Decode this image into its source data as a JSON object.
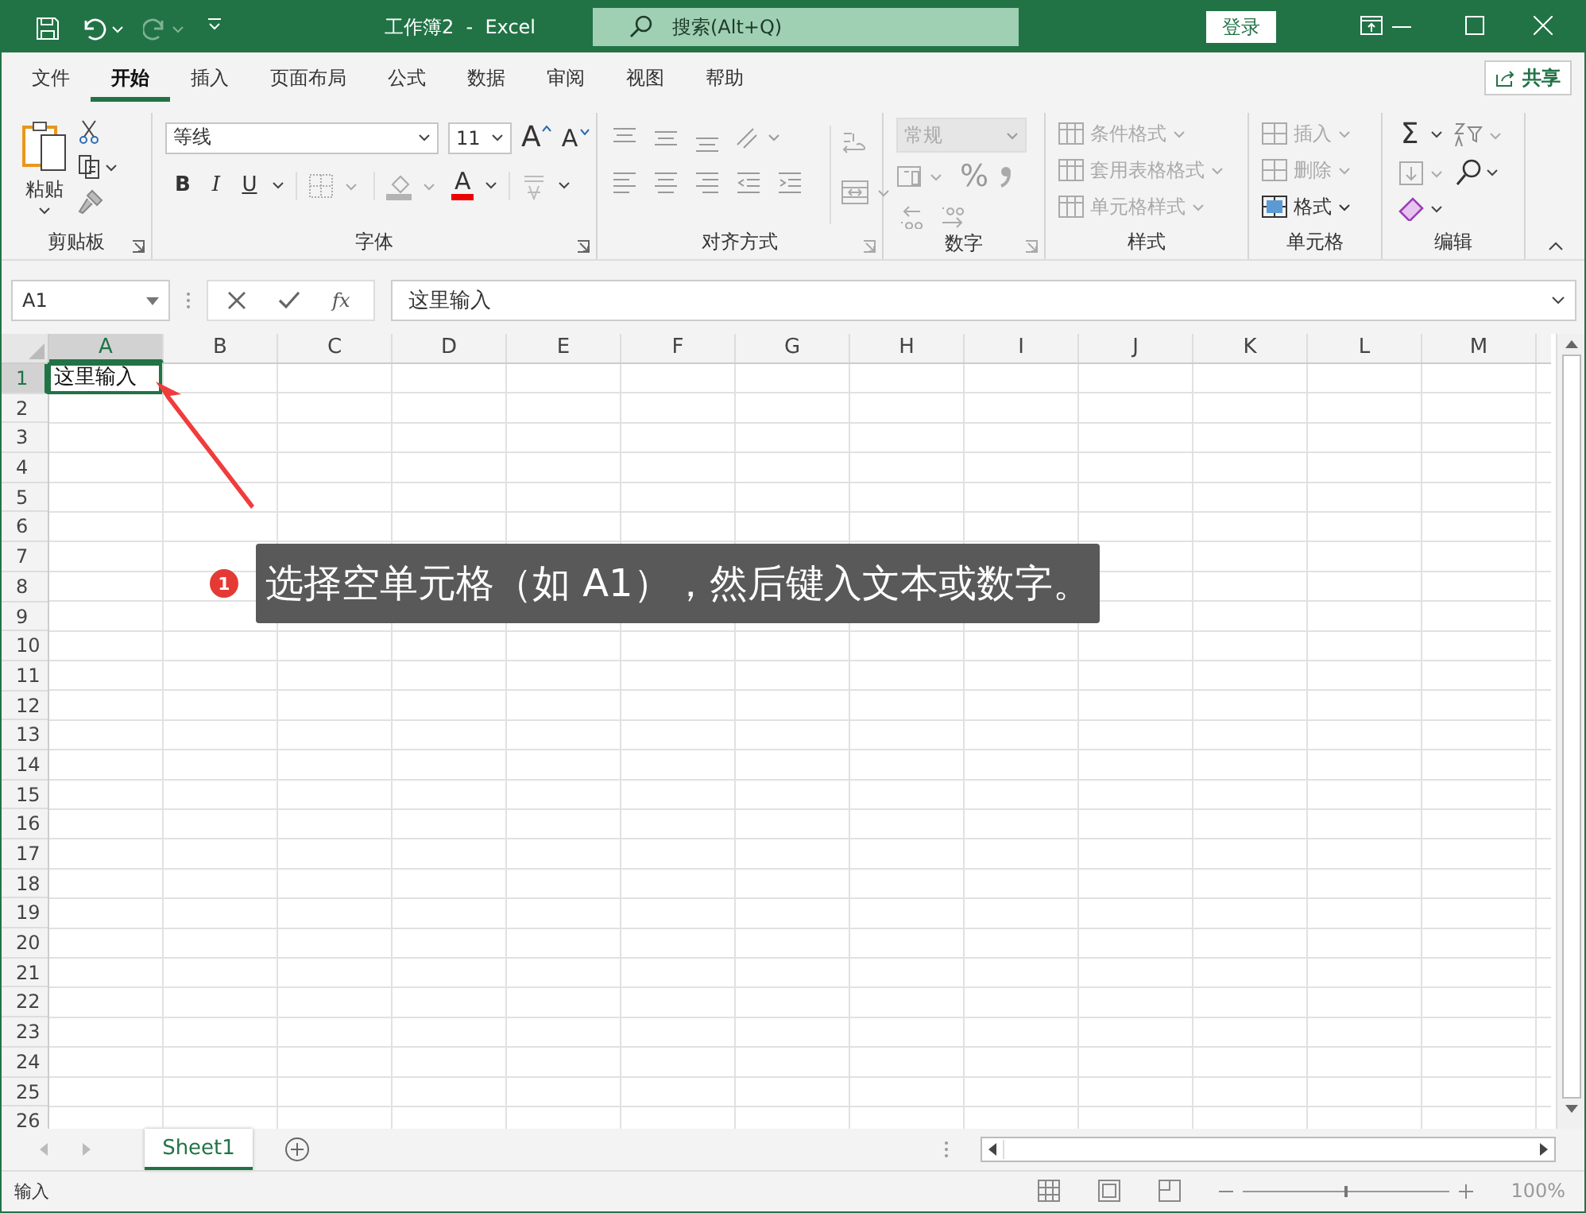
{
  "title_bar": {
    "title": "工作簿2  -  Excel",
    "search_placeholder": "搜索(Alt+Q)",
    "login_button": "登录"
  },
  "menu_tabs": [
    {
      "label": "文件",
      "selected": false
    },
    {
      "label": "开始",
      "selected": true
    },
    {
      "label": "插入",
      "selected": false
    },
    {
      "label": "页面布局",
      "selected": false
    },
    {
      "label": "公式",
      "selected": false
    },
    {
      "label": "数据",
      "selected": false
    },
    {
      "label": "审阅",
      "selected": false
    },
    {
      "label": "视图",
      "selected": false
    },
    {
      "label": "帮助",
      "selected": false
    }
  ],
  "share_button": "共享",
  "ribbon": {
    "clipboard": {
      "label": "剪贴板",
      "paste": "粘贴"
    },
    "font": {
      "label": "字体",
      "font_name": "等线",
      "font_size": "11",
      "grow_font": "A",
      "shrink_font": "A",
      "style_buttons": [
        "B",
        "I",
        "U"
      ],
      "font_color": "A"
    },
    "alignment": {
      "label": "对齐方式"
    },
    "number": {
      "label": "数字",
      "format": {
        "value": "常规",
        "disabled": true
      },
      "percent": "%"
    },
    "styles": {
      "label": "样式",
      "items": [
        {
          "label": "条件格式",
          "disabled": true
        },
        {
          "label": "套用表格格式",
          "disabled": true
        },
        {
          "label": "单元格样式",
          "disabled": true
        }
      ]
    },
    "cells": {
      "label": "单元格",
      "items": [
        {
          "label": "插入",
          "disabled": true
        },
        {
          "label": "删除",
          "disabled": true
        },
        {
          "label": "格式",
          "disabled": false
        }
      ]
    },
    "editing": {
      "label": "编辑",
      "autosum": "Σ"
    }
  },
  "formula_bar": {
    "name_box": "A1",
    "function_button": "fx",
    "formula": "这里输入"
  },
  "sheet": {
    "columns": [
      {
        "label": "A",
        "selected": true
      },
      {
        "label": "B",
        "selected": false
      },
      {
        "label": "C",
        "selected": false
      },
      {
        "label": "D",
        "selected": false
      },
      {
        "label": "E",
        "selected": false
      },
      {
        "label": "F",
        "selected": false
      },
      {
        "label": "G",
        "selected": false
      },
      {
        "label": "H",
        "selected": false
      },
      {
        "label": "I",
        "selected": false
      },
      {
        "label": "J",
        "selected": false
      },
      {
        "label": "K",
        "selected": false
      },
      {
        "label": "L",
        "selected": false
      },
      {
        "label": "M",
        "selected": false
      }
    ],
    "rows": [
      {
        "label": "1",
        "selected": true
      },
      {
        "label": "2",
        "selected": false
      },
      {
        "label": "3",
        "selected": false
      },
      {
        "label": "4",
        "selected": false
      },
      {
        "label": "5",
        "selected": false
      },
      {
        "label": "6",
        "selected": false
      },
      {
        "label": "7",
        "selected": false
      },
      {
        "label": "8",
        "selected": false
      },
      {
        "label": "9",
        "selected": false
      },
      {
        "label": "10",
        "selected": false
      },
      {
        "label": "11",
        "selected": false
      },
      {
        "label": "12",
        "selected": false
      },
      {
        "label": "13",
        "selected": false
      },
      {
        "label": "14",
        "selected": false
      },
      {
        "label": "15",
        "selected": false
      },
      {
        "label": "16",
        "selected": false
      },
      {
        "label": "17",
        "selected": false
      },
      {
        "label": "18",
        "selected": false
      },
      {
        "label": "19",
        "selected": false
      },
      {
        "label": "20",
        "selected": false
      },
      {
        "label": "21",
        "selected": false
      },
      {
        "label": "22",
        "selected": false
      },
      {
        "label": "23",
        "selected": false
      },
      {
        "label": "24",
        "selected": false
      },
      {
        "label": "25",
        "selected": false
      },
      {
        "label": "26",
        "selected": false
      }
    ],
    "active_cell_value": "这里输入"
  },
  "callout": {
    "number": "1",
    "text": "选择空单元格（如 A1），然后键入文本或数字。"
  },
  "sheet_tabs": [
    {
      "label": "Sheet1",
      "selected": true
    }
  ],
  "status_bar": {
    "mode": "输入",
    "zoom_slider": {
      "level": 0.5
    },
    "zoom": "100%"
  }
}
